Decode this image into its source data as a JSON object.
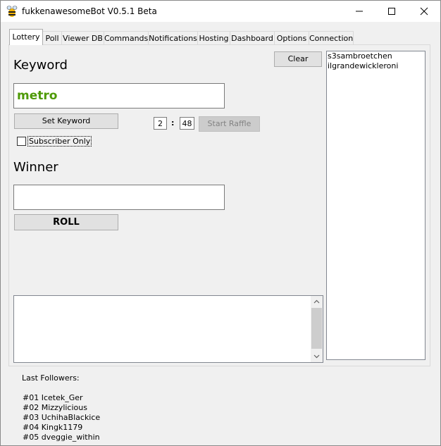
{
  "window": {
    "title": "fukkenawesomeBot V0.5.1 Beta",
    "minimize_icon": "minimize-icon",
    "maximize_icon": "maximize-icon",
    "close_icon": "close-icon"
  },
  "tabs": [
    {
      "label": "Lottery",
      "active": true
    },
    {
      "label": "Poll"
    },
    {
      "label": "Viewer DB"
    },
    {
      "label": "Commands"
    },
    {
      "label": "Notifications"
    },
    {
      "label": "Hosting"
    },
    {
      "label": "Dashboard"
    },
    {
      "label": "Options"
    },
    {
      "label": "Connection"
    }
  ],
  "lottery": {
    "keyword_label": "Keyword",
    "keyword_value": "metro",
    "keyword_color": "#4e9a06",
    "set_keyword_label": "Set Keyword",
    "subscriber_only_label": "Subscriber Only",
    "subscriber_only_checked": false,
    "minutes": "2",
    "colon": ":",
    "seconds": "48",
    "start_raffle_label": "Start Raffle",
    "clear_label": "Clear",
    "winner_label": "Winner",
    "winner_value": "",
    "roll_label": "ROLL",
    "entrants": [
      "s3sambroetchen",
      "ilgrandewickleroni"
    ]
  },
  "followers": {
    "header": "Last Followers:",
    "items": [
      "#01 Icetek_Ger",
      "#02 Mizzylicious",
      "#03 UchihaBlackice",
      "#04 Kingk1179",
      "#05 dveggie_within"
    ]
  }
}
